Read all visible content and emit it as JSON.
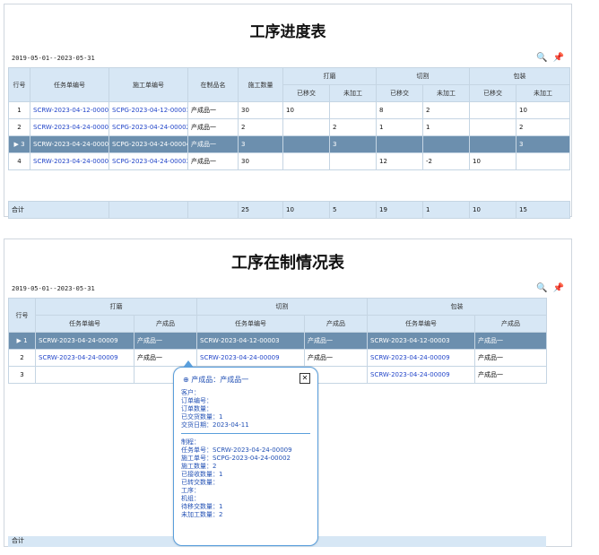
{
  "top": {
    "title": "工序进度表",
    "range": "2019-05-01--2023-05-31",
    "search_icon": "search-icon",
    "pin_icon": "pin-icon",
    "header_row1": [
      "行号",
      "任务单编号",
      "施工单编号",
      "在制品名",
      "施工数量",
      "打磨",
      "切割",
      "包装"
    ],
    "header_sub": [
      "已移交",
      "未加工",
      "已移交",
      "未加工",
      "已移交",
      "未加工"
    ],
    "rows": [
      {
        "no": "1",
        "task": "SCRW-2023-04-12-00003",
        "work": "SCPG-2023-04-12-00001",
        "product": "产成品一",
        "qty": "30",
        "s1": "10",
        "s2": "",
        "s3": "8",
        "s4": "2",
        "s5": "",
        "s6": "10",
        "selected": false
      },
      {
        "no": "2",
        "task": "SCRW-2023-04-24-00009",
        "work": "SCPG-2023-04-24-00002",
        "product": "产成品一",
        "qty": "2",
        "s1": "",
        "s2": "2",
        "s3": "1",
        "s4": "1",
        "s5": "",
        "s6": "2",
        "selected": false
      },
      {
        "no": "3",
        "task": "SCRW-2023-04-24-00009",
        "work": "SCPG-2023-04-24-00004",
        "product": "产成品一",
        "qty": "3",
        "s1": "",
        "s2": "3",
        "s3": "",
        "s4": "",
        "s5": "",
        "s6": "3",
        "selected": true
      },
      {
        "no": "4",
        "task": "SCRW-2023-04-24-00009",
        "work": "SCPG-2023-04-24-00003",
        "product": "产成品一",
        "qty": "30",
        "s1": "",
        "s2": "",
        "s3": "12",
        "s4": "-2",
        "s5": "10",
        "s6": "",
        "selected": false
      }
    ],
    "sum": {
      "label": "合计",
      "qty": "25",
      "s1": "10",
      "s2": "5",
      "s3": "19",
      "s4": "1",
      "s5": "10",
      "s6": "15"
    }
  },
  "bottom": {
    "title": "工序在制情况表",
    "range": "2019-05-01--2023-05-31",
    "header_row1": [
      "行号",
      "打磨",
      "切割",
      "包装"
    ],
    "header_sub": [
      "任务单编号",
      "产成品",
      "任务单编号",
      "产成品",
      "任务单编号",
      "产成品"
    ],
    "rows": [
      {
        "no": "1",
        "a_task": "SCRW-2023-04-24-00009",
        "a_prod": "产成品一",
        "b_task": "SCRW-2023-04-12-00003",
        "b_prod": "产成品一",
        "c_task": "SCRW-2023-04-12-00003",
        "c_prod": "产成品一"
      },
      {
        "no": "2",
        "a_task": "SCRW-2023-04-24-00009",
        "a_prod": "产成品一",
        "b_task": "SCRW-2023-04-24-00009",
        "b_prod": "产成品一",
        "c_task": "SCRW-2023-04-24-00009",
        "c_prod": "产成品一"
      },
      {
        "no": "3",
        "a_task": "",
        "a_prod": "",
        "b_task": "",
        "b_prod": "",
        "c_task": "SCRW-2023-04-24-00009",
        "c_prod": "产成品一"
      }
    ],
    "sum_label": "合计",
    "popup": {
      "header": "产成品：产成品一",
      "close": "✕",
      "lines1": [
        "客户：",
        "订单编号：",
        "订单数量：",
        "已交货数量：1",
        "交货日期：2023-04-11"
      ],
      "lines2": [
        "制程：",
        "任务单号：SCRW-2023-04-24-00009",
        "施工单号：SCPG-2023-04-24-00002",
        "施工数量：2",
        "已接收数量：1",
        "已转交数量：",
        "工序：",
        "机组：",
        "待移交数量：1",
        "未加工数量：2"
      ]
    }
  }
}
